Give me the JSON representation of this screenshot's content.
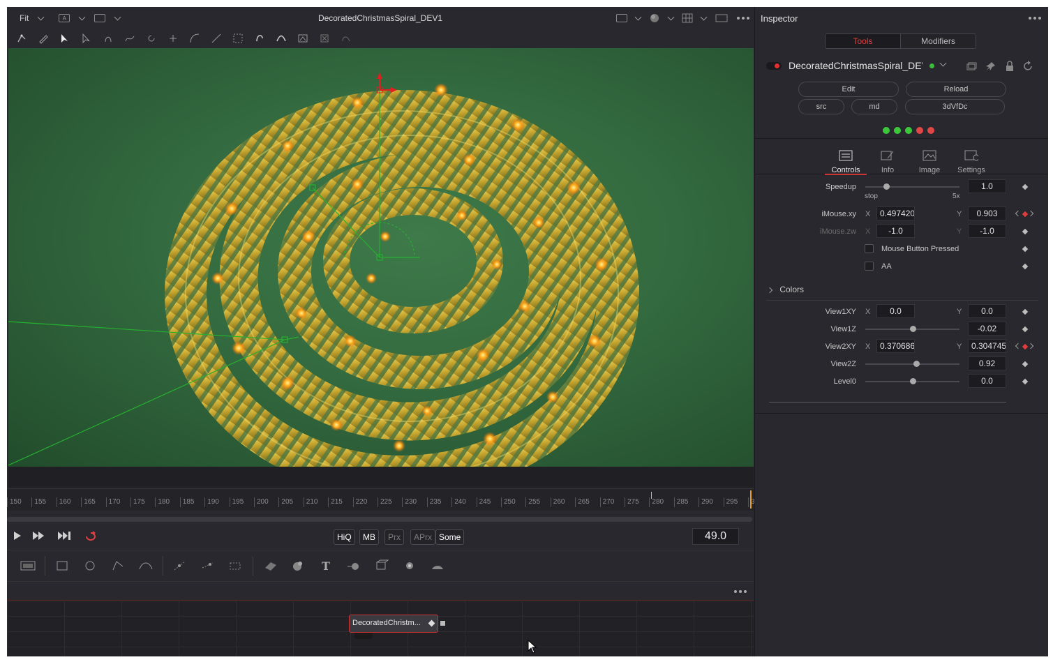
{
  "viewer": {
    "fit_label": "Fit",
    "title": "DecoratedChristmasSpiral_DEV1",
    "channel_label": "A"
  },
  "ruler": {
    "ticks": [
      "150",
      "155",
      "160",
      "165",
      "170",
      "175",
      "180",
      "185",
      "190",
      "195",
      "200",
      "205",
      "210",
      "215",
      "220",
      "225",
      "230",
      "235",
      "240",
      "245",
      "250",
      "255",
      "260",
      "265",
      "270",
      "275",
      "280",
      "285",
      "290",
      "295",
      "3"
    ]
  },
  "transport": {
    "buttons": [
      "HiQ",
      "MB",
      "Prx",
      "APrx",
      "Some"
    ],
    "frame": "49.0"
  },
  "node": {
    "label": "DecoratedChristm..."
  },
  "inspector": {
    "title": "Inspector",
    "tabs": {
      "tools": "Tools",
      "modifiers": "Modifiers"
    },
    "tool_name": "DecoratedChristmasSpiral_DEV",
    "buttons": {
      "edit": "Edit",
      "reload": "Reload",
      "src": "src",
      "md": "md",
      "id": "3dVfDc"
    },
    "panel_tabs": {
      "controls": "Controls",
      "info": "Info",
      "image": "Image",
      "settings": "Settings"
    },
    "speedup": {
      "label": "Speedup",
      "value": "1.0",
      "min_label": "stop",
      "max_label": "5x",
      "level": 0.22
    },
    "imouse_xy": {
      "label": "iMouse.xy",
      "x_label": "X",
      "x": "0.497420",
      "y_label": "Y",
      "y": "0.903"
    },
    "imouse_zw": {
      "label": "iMouse.zw",
      "x_label": "X",
      "x": "-1.0",
      "y_label": "Y",
      "y": "-1.0"
    },
    "mouse_pressed": "Mouse Button Pressed",
    "aa": "AA",
    "colors_label": "Colors",
    "view1xy": {
      "label": "View1XY",
      "x_label": "X",
      "x": "0.0",
      "y_label": "Y",
      "y": "0.0"
    },
    "view1z": {
      "label": "View1Z",
      "value": "-0.02",
      "level": 0.5
    },
    "view2xy": {
      "label": "View2XY",
      "x_label": "X",
      "x": "0.370686",
      "y_label": "Y",
      "y": "0.304745"
    },
    "view2z": {
      "label": "View2Z",
      "value": "0.92",
      "level": 0.54
    },
    "level0": {
      "label": "Level0",
      "value": "0.0",
      "level": 0.5
    }
  },
  "colors": {
    "accent": "#e04040",
    "led_green": "#3cc83c",
    "led_red": "#e04848",
    "viewport_bg": "#336a3f"
  }
}
